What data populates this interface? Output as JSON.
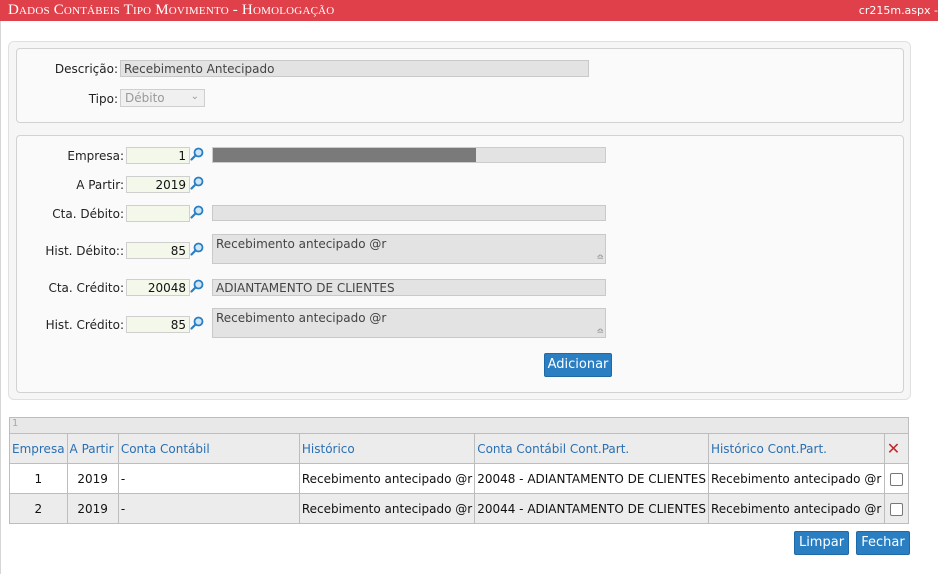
{
  "window": {
    "title": "Dados Contábeis Tipo Movimento  - Homologação",
    "file": "cr215m.aspx -"
  },
  "header_section": {
    "descricao_label": "Descrição:",
    "descricao_value": "Recebimento Antecipado",
    "tipo_label": "Tipo:",
    "tipo_value": "Débito"
  },
  "form": {
    "empresa_label": "Empresa:",
    "empresa_value": "1",
    "empresa_progress": 0.67,
    "a_partir_label": "A Partir:",
    "a_partir_value": "2019",
    "cta_debito_label": "Cta. Débito:",
    "cta_debito_value": "",
    "cta_debito_desc": "",
    "hist_debito_label": "Hist. Débito::",
    "hist_debito_value": "85",
    "hist_debito_desc": "Recebimento antecipado @r",
    "cta_credito_label": "Cta. Crédito:",
    "cta_credito_value": "20048",
    "cta_credito_desc": "ADIANTAMENTO DE CLIENTES",
    "hist_credito_label": "Hist. Crédito:",
    "hist_credito_value": "85",
    "hist_credito_desc": "Recebimento antecipado @r",
    "add_button": "Adicionar"
  },
  "grid": {
    "pager": "1",
    "columns": [
      "Empresa",
      "A Partir",
      "Conta Contábil",
      "Histórico",
      "Conta Contábil Cont.Part.",
      "Histórico Cont.Part."
    ],
    "rows": [
      [
        "1",
        "2019",
        "-",
        "Recebimento antecipado @r",
        "20048 - ADIANTAMENTO DE CLIENTES",
        "Recebimento antecipado @r"
      ],
      [
        "2",
        "2019",
        "-",
        "Recebimento antecipado @r",
        "20044 - ADIANTAMENTO DE CLIENTES",
        "Recebimento antecipado @r"
      ]
    ]
  },
  "footer": {
    "limpar": "Limpar",
    "fechar": "Fechar"
  },
  "colors": {
    "titlebar": "#e0404a",
    "button": "#2a7ec2",
    "header_text": "#2a6fb3",
    "delete_icon": "#c0282a"
  },
  "icons": {
    "lookup": "magnifier-icon",
    "delete": "delete-x-icon",
    "select": "chevron-down-icon"
  }
}
